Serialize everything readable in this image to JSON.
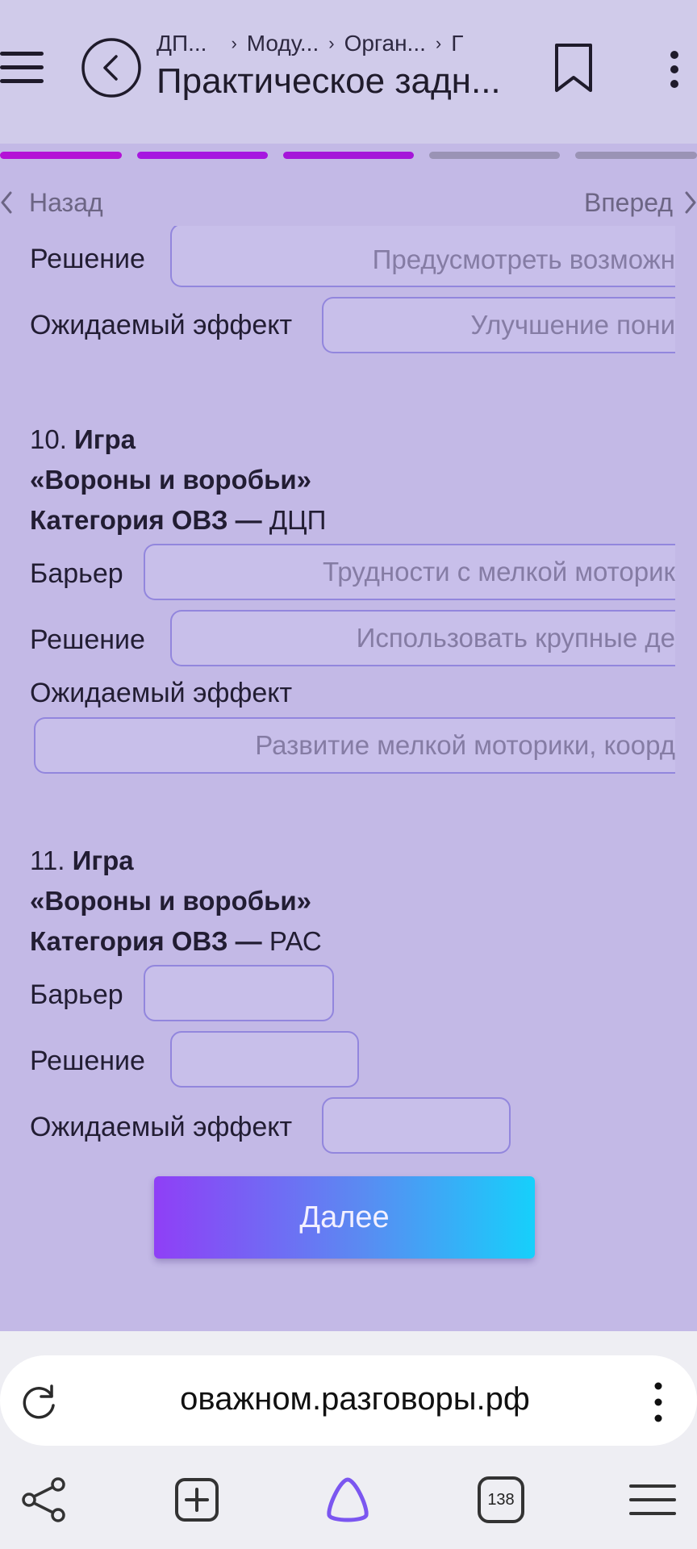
{
  "header": {
    "breadcrumbs": [
      "ДП...",
      "Моду...",
      "Орган...",
      "Г"
    ],
    "title": "Практическое задн..."
  },
  "progress": {
    "segments": [
      {
        "state": "done",
        "color": "#b412d6"
      },
      {
        "state": "done",
        "color": "#a616e0"
      },
      {
        "state": "done",
        "color": "#a516d9"
      },
      {
        "state": "pending",
        "color": "#9a93b5"
      },
      {
        "state": "pending",
        "color": "#9a93b5"
      }
    ]
  },
  "nav": {
    "back_label": "Назад",
    "forward_label": "Вперед"
  },
  "labels": {
    "barrier": "Барьер",
    "solution": "Решение",
    "effect": "Ожидаемый эффект"
  },
  "partial_item": {
    "solution_value": "Предусмотреть возможн",
    "effect_value": "Улучшение пони"
  },
  "item10": {
    "number": "10.",
    "line1_bold": "Игра",
    "line2_bold": "«Вороны и воробьи»",
    "category_bold": "Категория ОВЗ —",
    "category_value": "ДЦП",
    "barrier_value": "Трудности с мелкой моторик",
    "solution_value": "Использовать крупные де",
    "effect_value": "Развитие мелкой моторики, коорд"
  },
  "item11": {
    "number": "11.",
    "line1_bold": "Игра",
    "line2_bold": "«Вороны и воробьи»",
    "category_bold": "Категория ОВЗ —",
    "category_value": "РАС",
    "barrier_value": "",
    "solution_value": "",
    "effect_value": ""
  },
  "next_button": "Далее",
  "browser": {
    "url": "оважном.разговоры.рф",
    "tabs_count": "138"
  },
  "colors": {
    "background": "#c3b9e6",
    "header_bg": "#d0cbea",
    "field_border": "#9286dd",
    "button_gradient_start": "#8f3ff6",
    "button_gradient_end": "#16d0fb"
  }
}
